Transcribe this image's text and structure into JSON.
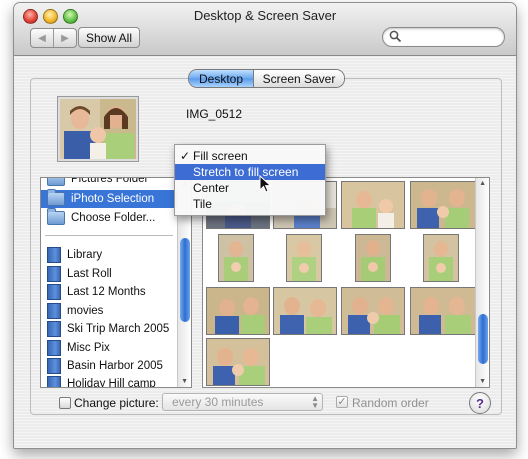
{
  "window": {
    "title": "Desktop & Screen Saver"
  },
  "toolbar": {
    "back_glyph": "◀",
    "forward_glyph": "▶",
    "show_all_label": "Show All",
    "search_value": ""
  },
  "tabs": [
    {
      "label": "Desktop",
      "selected": true
    },
    {
      "label": "Screen Saver",
      "selected": false
    }
  ],
  "preview": {
    "image_name": "IMG_0512"
  },
  "source_list": {
    "items": [
      {
        "label": "Pictures Folder",
        "icon": "folder-icon",
        "selected": false
      },
      {
        "label": "iPhoto Selection",
        "icon": "folder-icon",
        "selected": true
      },
      {
        "label": "Choose Folder...",
        "icon": "folder-icon",
        "selected": false
      },
      {
        "label": "Library",
        "icon": "album-icon",
        "selected": false
      },
      {
        "label": "Last Roll",
        "icon": "album-icon",
        "selected": false
      },
      {
        "label": "Last 12 Months",
        "icon": "album-icon",
        "selected": false
      },
      {
        "label": "movies",
        "icon": "album-icon",
        "selected": false
      },
      {
        "label": "Ski Trip March 2005",
        "icon": "album-icon",
        "selected": false
      },
      {
        "label": "Misc Pix",
        "icon": "album-icon",
        "selected": false
      },
      {
        "label": "Basin Harbor 2005",
        "icon": "album-icon",
        "selected": false
      },
      {
        "label": "Holiday Hill camp",
        "icon": "album-icon",
        "selected": false
      }
    ]
  },
  "popup_menu": {
    "items": [
      {
        "label": "Fill screen",
        "checked": true,
        "highlighted": false
      },
      {
        "label": "Stretch to fill screen",
        "checked": false,
        "highlighted": true
      },
      {
        "label": "Center",
        "checked": false,
        "highlighted": false
      },
      {
        "label": "Tile",
        "checked": false,
        "highlighted": false
      }
    ],
    "check_glyph": "✓"
  },
  "bottom": {
    "change_picture_label": "Change picture:",
    "change_picture_checked": false,
    "interval_value": "every 30 minutes",
    "random_order_label": "Random order",
    "random_order_checked": true,
    "help_label": "?"
  },
  "colors": {
    "selection": "#3875d7",
    "menu_highlight": "#3d6cd4",
    "tab_selected": "#6aa8ef"
  }
}
